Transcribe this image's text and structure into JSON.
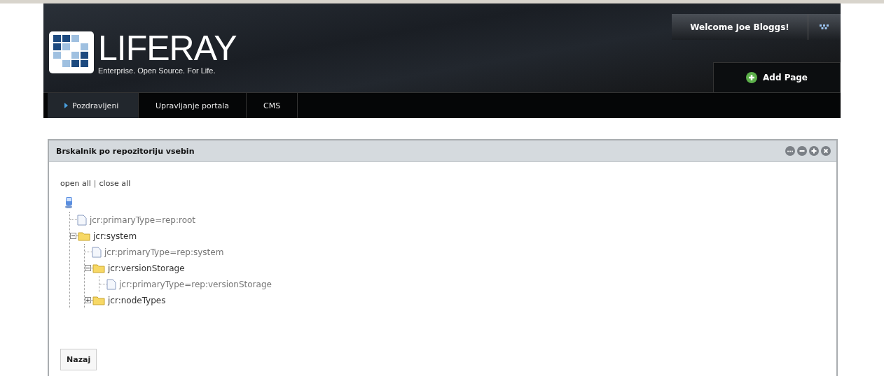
{
  "logo": {
    "name": "LIFERAY",
    "tagline": "Enterprise. Open Source. For Life."
  },
  "user_menu": {
    "welcome": "Welcome Joe Bloggs!"
  },
  "add_page": {
    "label": "Add Page"
  },
  "nav": [
    {
      "label": "Pozdravljeni",
      "selected": true
    },
    {
      "label": "Upravljanje portala",
      "selected": false
    },
    {
      "label": "CMS",
      "selected": false
    }
  ],
  "portlet": {
    "title": "Brskalnik po repozitoriju vsebin",
    "links": [
      {
        "label": "open all"
      },
      {
        "label": "close all"
      }
    ],
    "link_separator": "|",
    "tree": [
      {
        "kind": "property",
        "label": "jcr:primaryType=rep:root"
      },
      {
        "kind": "folder",
        "label": "jcr:system",
        "expanded": true,
        "children": [
          {
            "kind": "property",
            "label": "jcr:primaryType=rep:system"
          },
          {
            "kind": "folder",
            "label": "jcr:versionStorage",
            "expanded": true,
            "children": [
              {
                "kind": "property",
                "label": "jcr:primaryType=rep:versionStorage"
              }
            ]
          },
          {
            "kind": "folder",
            "label": "jcr:nodeTypes",
            "expanded": false
          }
        ]
      }
    ],
    "back_button": "Nazaj"
  }
}
